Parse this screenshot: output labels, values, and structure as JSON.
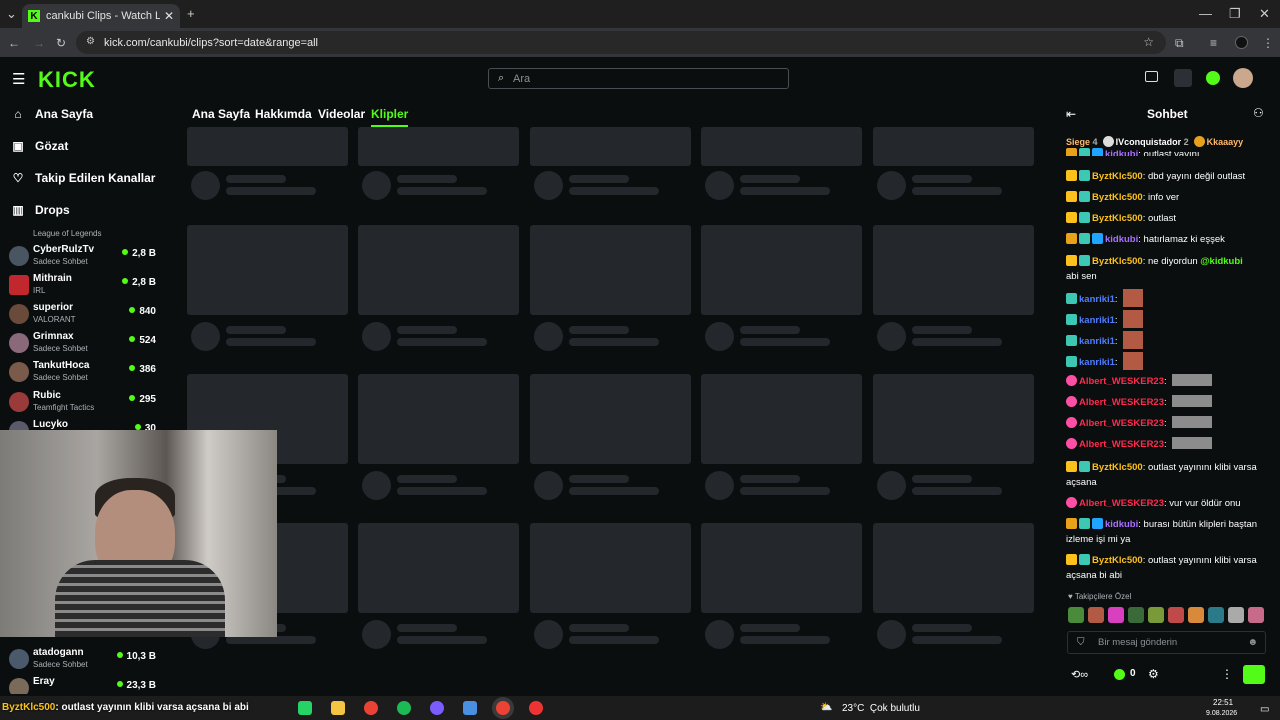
{
  "browser": {
    "tab_title": "cankubi Clips - Watch Live on Kick",
    "url": "kick.com/cankubi/clips?sort=date&range=all"
  },
  "header": {
    "logo": "KICK",
    "search_placeholder": "Ara"
  },
  "sidebar": {
    "nav": [
      {
        "label": "Ana Sayfa",
        "icon": "home-icon"
      },
      {
        "label": "Gözat",
        "icon": "browse-icon"
      },
      {
        "label": "Takip Edilen Kanallar",
        "icon": "heart-icon"
      },
      {
        "label": "Drops",
        "icon": "drops-icon"
      }
    ],
    "first_category": "League of Legends",
    "channels": [
      {
        "name": "CyberRulzTv",
        "category": "Sadece Sohbet",
        "viewers": "2,8 B"
      },
      {
        "name": "Mithrain",
        "category": "IRL",
        "viewers": "2,8 B"
      },
      {
        "name": "superior",
        "category": "VALORANT",
        "viewers": "840"
      },
      {
        "name": "Grimnax",
        "category": "Sadece Sohbet",
        "viewers": "524"
      },
      {
        "name": "TankutHoca",
        "category": "Sadece Sohbet",
        "viewers": "386"
      },
      {
        "name": "Rubic",
        "category": "Teamfight Tactics",
        "viewers": "295"
      },
      {
        "name": "Lucyko",
        "category": "",
        "viewers": "30"
      }
    ],
    "bottom_channels": [
      {
        "name": "atadogann",
        "category": "Sadece Sohbet",
        "viewers": "10,3 B"
      },
      {
        "name": "Eray",
        "category": "",
        "viewers": "23,3 B"
      }
    ]
  },
  "page_tabs": [
    "Ana Sayfa",
    "Hakkımda",
    "Videolar",
    "Klipler"
  ],
  "active_tab": "Klipler",
  "chat": {
    "title": "Sohbet",
    "top_gifters": [
      {
        "name": "Siege",
        "count": "4"
      },
      {
        "name": "IVconquistador",
        "count": "2"
      },
      {
        "name": "Kkaaayy",
        "count": ""
      }
    ],
    "messages": [
      {
        "user": "kidkubi",
        "text": "outlast yayını",
        "color": "#a970ff"
      },
      {
        "user": "ByztKlc500",
        "text": "dbd yayını değil outlast",
        "color": "#fcc21b"
      },
      {
        "user": "ByztKlc500",
        "text": "info ver",
        "color": "#fcc21b"
      },
      {
        "user": "ByztKlc500",
        "text": "outlast",
        "color": "#fcc21b"
      },
      {
        "user": "kidkubi",
        "text": "hatırlamaz ki eşşek",
        "color": "#a970ff"
      },
      {
        "user": "ByztKlc500",
        "text": "ne diyordun",
        "mention": "@kidkubi",
        "text2": "abi sen",
        "color": "#fcc21b"
      },
      {
        "user": "kanriki1",
        "text": "",
        "color": "#4f7dff"
      },
      {
        "user": "kanriki1",
        "text": "",
        "color": "#4f7dff"
      },
      {
        "user": "kanriki1",
        "text": "",
        "color": "#4f7dff"
      },
      {
        "user": "kanriki1",
        "text": "",
        "color": "#4f7dff"
      },
      {
        "user": "Albert_WESKER23",
        "text": "",
        "color": "#ff2a4e"
      },
      {
        "user": "Albert_WESKER23",
        "text": "",
        "color": "#ff2a4e"
      },
      {
        "user": "Albert_WESKER23",
        "text": "",
        "color": "#ff2a4e"
      },
      {
        "user": "Albert_WESKER23",
        "text": "",
        "color": "#ff2a4e"
      },
      {
        "user": "ByztKlc500",
        "text": "outlast yayınını klibi varsa açsana",
        "color": "#fcc21b"
      },
      {
        "user": "Albert_WESKER23",
        "text": "vur vur öldür onu",
        "color": "#ff2a4e"
      },
      {
        "user": "kidkubi",
        "text": "burası bütün klipleri baştan izleme işi mi ya",
        "color": "#a970ff"
      },
      {
        "user": "ByztKlc500",
        "text": "outlast yayınını klibi varsa açsana bi abi",
        "color": "#fcc21b"
      }
    ],
    "emote_label": "Takipçilere Özel",
    "input_placeholder": "Bir mesaj gönderin",
    "points": "0"
  },
  "taskbar": {
    "overlay_user": "ByztKlc500",
    "overlay_text": ": outlast yayının klibi varsa açsana bi abi",
    "weather": "23°C  Çok bulutlu",
    "time": "22:51",
    "date": "9.08.2026"
  }
}
